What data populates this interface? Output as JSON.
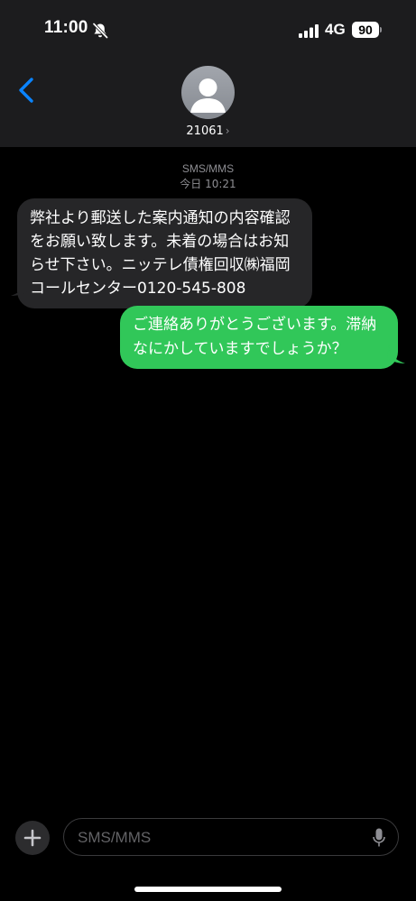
{
  "status_bar": {
    "time": "11:00",
    "network": "4G",
    "battery": "90"
  },
  "header": {
    "contact_name": "21061",
    "contact_chevron": "›"
  },
  "conversation": {
    "service_label": "SMS/MMS",
    "timestamp": "今日 10:21",
    "messages": [
      {
        "direction": "incoming",
        "text": "弊社より郵送した案内通知の内容確認をお願い致します。未着の場合はお知らせ下さい。ニッテレ債権回収㈱福岡コールセンター0120-545-808"
      },
      {
        "direction": "outgoing",
        "text": "ご連絡ありがとうございます。滞納なにかしていますでしょうか？"
      }
    ]
  },
  "input_bar": {
    "placeholder": "SMS/MMS"
  },
  "icons": {
    "back": "chevron-left-icon",
    "mute": "bell-slash-icon",
    "signal": "cellular-signal-icon",
    "add": "plus-icon",
    "dictation": "microphone-icon"
  },
  "colors": {
    "accent_blue": "#0a84ff",
    "outgoing_green": "#31c759",
    "incoming_gray": "#262628",
    "header_bg": "#1c1c1e",
    "background": "#000000"
  }
}
